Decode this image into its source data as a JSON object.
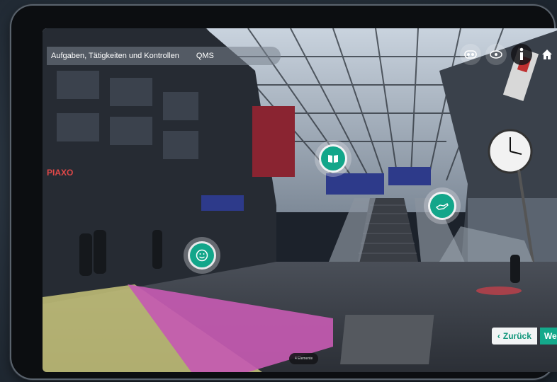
{
  "breadcrumb": {
    "items": [
      "Aufgaben, Tätigkeiten und Kontrollen",
      "QMS"
    ]
  },
  "toolbar": {
    "icons": [
      "vr-goggles-icon",
      "360-view-icon",
      "info-icon",
      "home-icon"
    ]
  },
  "hotspots": [
    "book-icon",
    "smiley-icon",
    "hand-icon"
  ],
  "navigation": {
    "back_label": "Zurück",
    "next_label": "Wei"
  },
  "scene_pill": "4 Elemente",
  "colors": {
    "accent": "#13a68a",
    "back_text": "#14977d"
  }
}
